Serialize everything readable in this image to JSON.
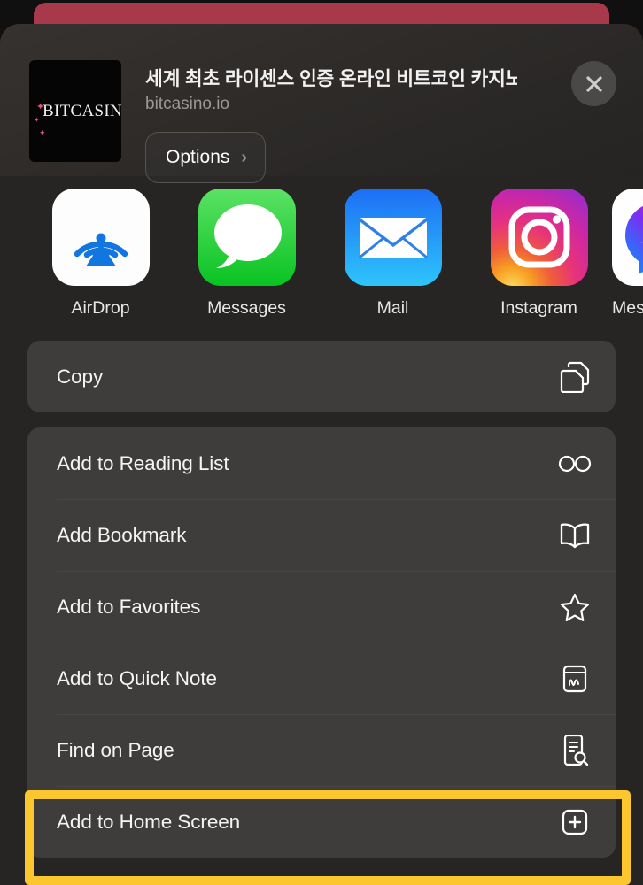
{
  "sheet": {
    "header": {
      "favicon_text": "BITCASIN",
      "title": "세계 최초 라이센스 인증 온라인 비트코인 카지노",
      "subtitle": "bitcasino.io",
      "options_label": "Options",
      "options_chevron": "›",
      "close_icon": "close-icon"
    },
    "apps": [
      {
        "label": "AirDrop",
        "icon": "airdrop-icon"
      },
      {
        "label": "Messages",
        "icon": "messages-icon"
      },
      {
        "label": "Mail",
        "icon": "mail-icon"
      },
      {
        "label": "Instagram",
        "icon": "instagram-icon"
      },
      {
        "label": "Mes",
        "icon": "messenger-icon"
      }
    ],
    "copy_panel": [
      {
        "label": "Copy",
        "icon": "copy-documents-icon"
      }
    ],
    "actions": [
      {
        "label": "Add to Reading List",
        "icon": "glasses-icon"
      },
      {
        "label": "Add Bookmark",
        "icon": "open-book-icon"
      },
      {
        "label": "Add to Favorites",
        "icon": "star-icon"
      },
      {
        "label": "Add to Quick Note",
        "icon": "quick-note-icon"
      },
      {
        "label": "Find on Page",
        "icon": "document-search-icon"
      }
    ],
    "highlighted_action": {
      "label": "Add to Home Screen",
      "icon": "plus-square-icon"
    }
  },
  "colors": {
    "highlight": "#FCC62E",
    "sheet_background": "#262524",
    "panel": "#3E3D3C",
    "page_strip": "#A8394A"
  }
}
